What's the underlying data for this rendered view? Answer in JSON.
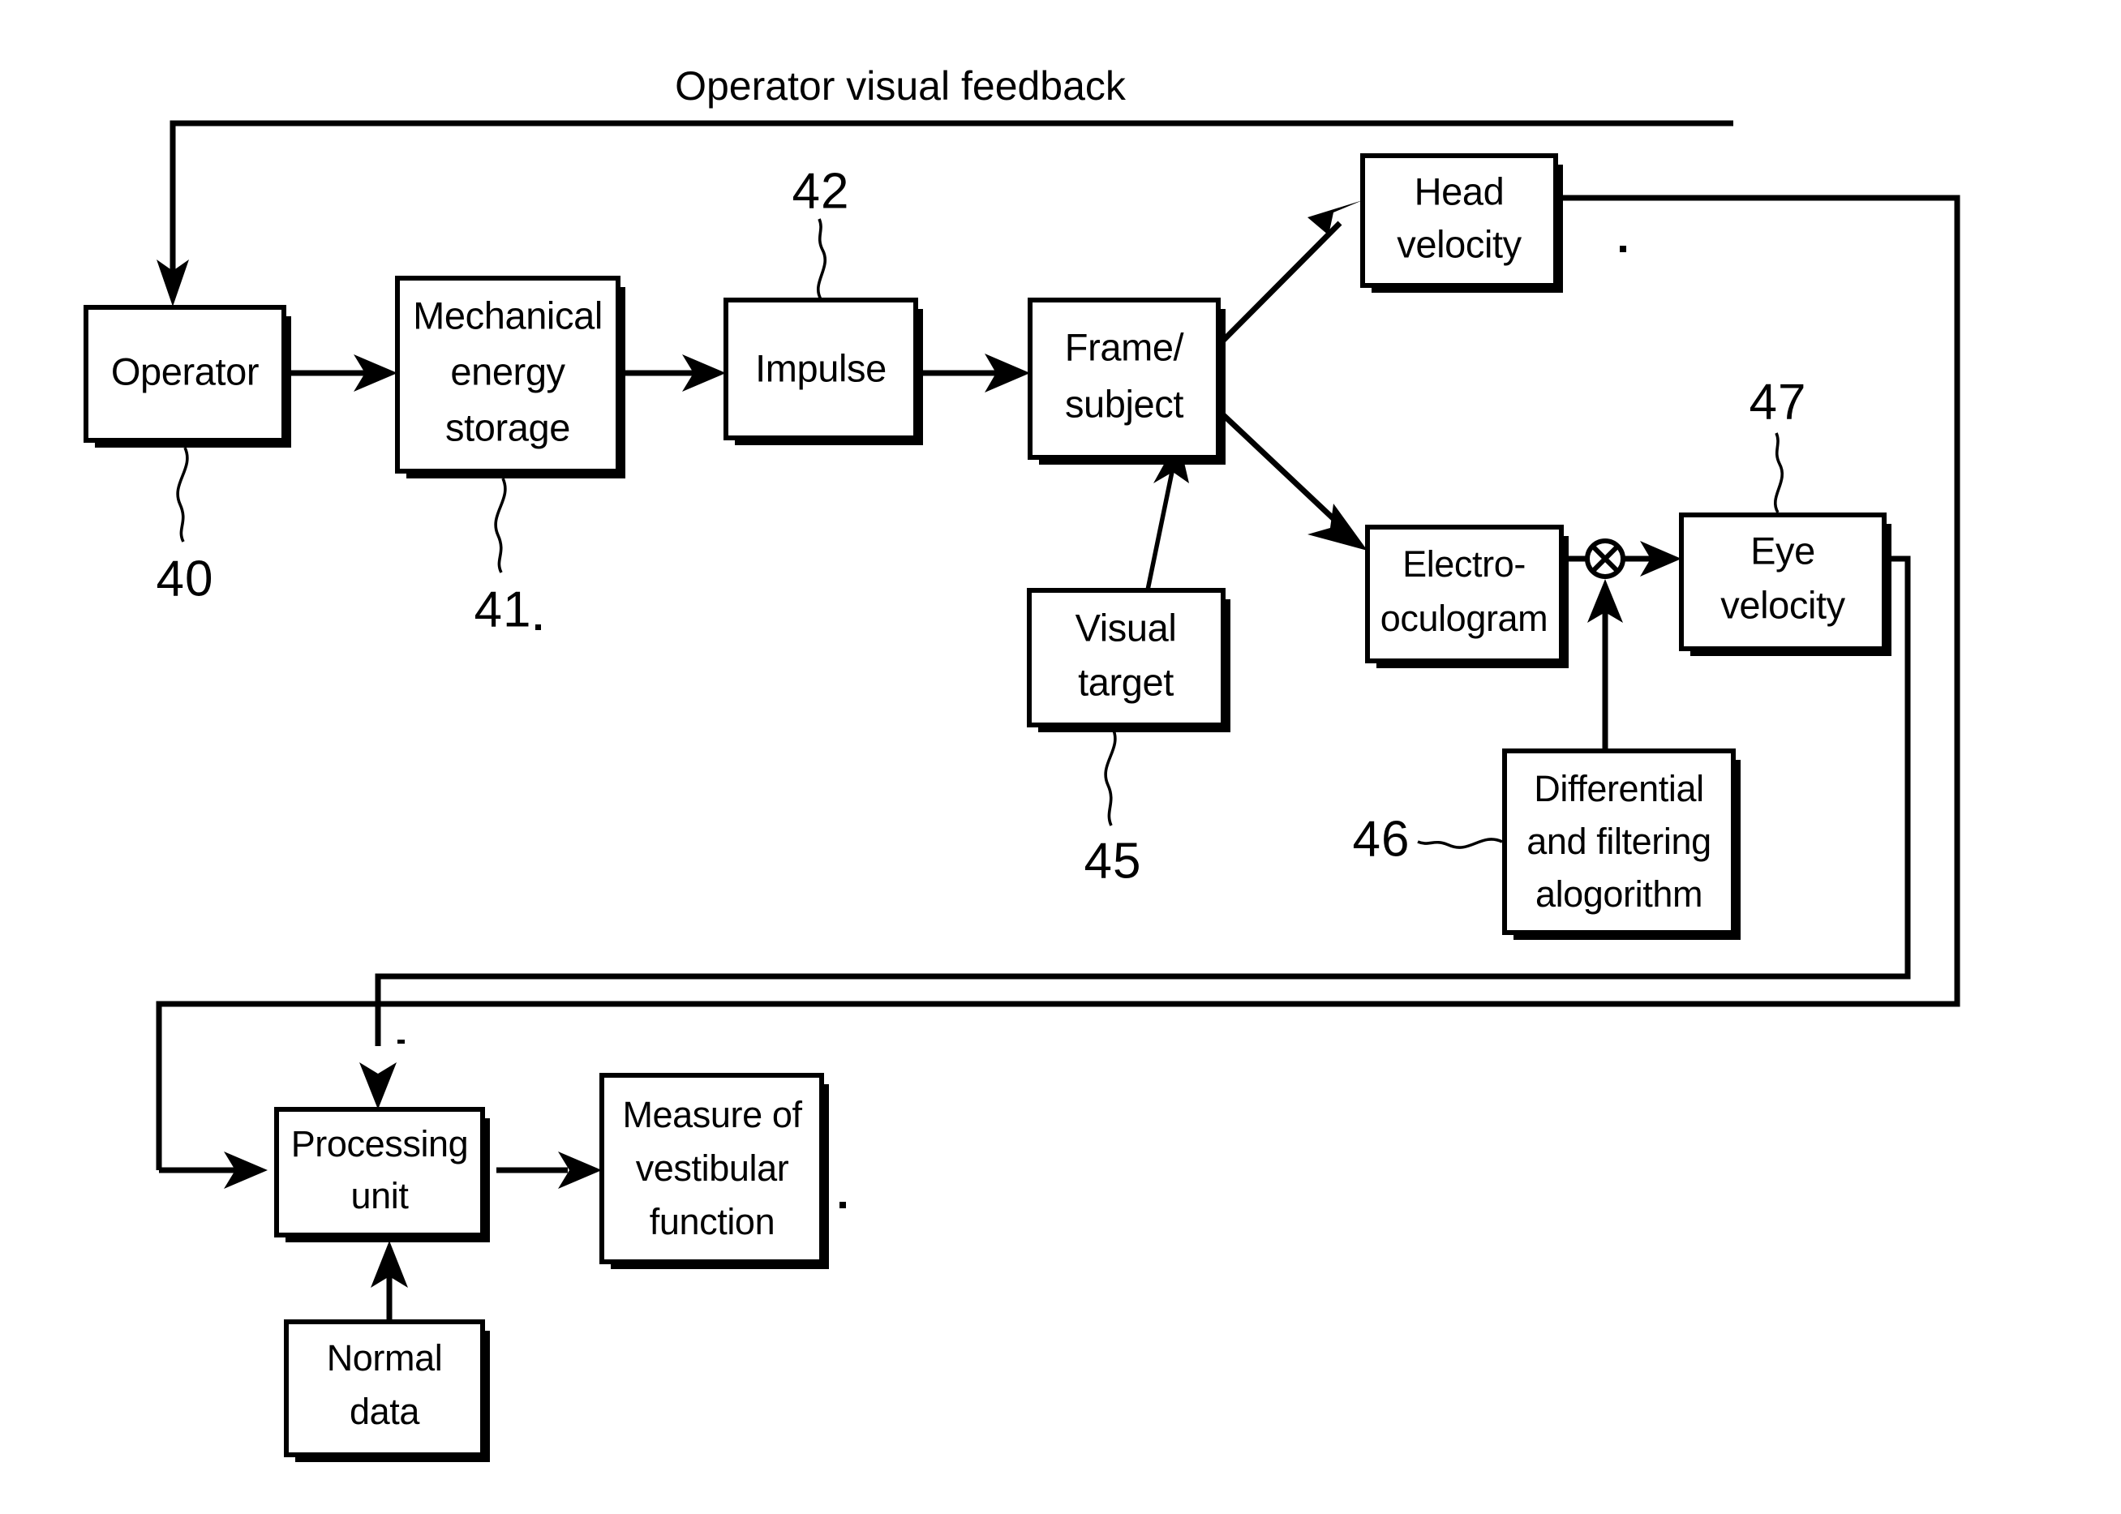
{
  "figure": {
    "title": "Operator visual feedback",
    "boxes": {
      "operator": {
        "label": "Operator",
        "lines": [
          "Operator"
        ]
      },
      "mechanical_energy_storage": {
        "label": "Mechanical energy storage",
        "lines": [
          "Mechanical",
          "energy",
          "storage"
        ]
      },
      "impulse": {
        "label": "Impulse",
        "lines": [
          "Impulse"
        ]
      },
      "frame_subject": {
        "label": "Frame/subject",
        "lines": [
          "Frame/",
          "subject"
        ]
      },
      "head_velocity": {
        "label": "Head velocity",
        "lines": [
          "Head",
          "velocity"
        ]
      },
      "visual_target": {
        "label": "Visual target",
        "lines": [
          "Visual",
          "target"
        ]
      },
      "electro_oculogram": {
        "label": "Electro-oculogram",
        "lines": [
          "Electro-",
          "oculogram"
        ]
      },
      "eye_velocity": {
        "label": "Eye velocity",
        "lines": [
          "Eye",
          "velocity"
        ]
      },
      "differential_and_filtering_algorithm": {
        "label": "Differential and filtering alogorithm",
        "lines": [
          "Differential",
          "and filtering",
          "alogorithm"
        ]
      },
      "processing_unit": {
        "label": "Processing unit",
        "lines": [
          "Processing",
          "unit"
        ]
      },
      "measure_of_vestibular_function": {
        "label": "Measure of vestibular function",
        "lines": [
          "Measure of",
          "vestibular",
          "function"
        ]
      },
      "normal_data": {
        "label": "Normal data",
        "lines": [
          "Normal",
          "data"
        ]
      }
    },
    "reference_numerals": {
      "operator": "40",
      "mechanical_energy_storage": "41",
      "impulse": "42",
      "visual_target": "45",
      "differential_and_filtering_algorithm": "46",
      "eye_velocity": "47"
    },
    "colors": {
      "line": "#000000",
      "fill": "#ffffff",
      "text": "#000000"
    }
  }
}
